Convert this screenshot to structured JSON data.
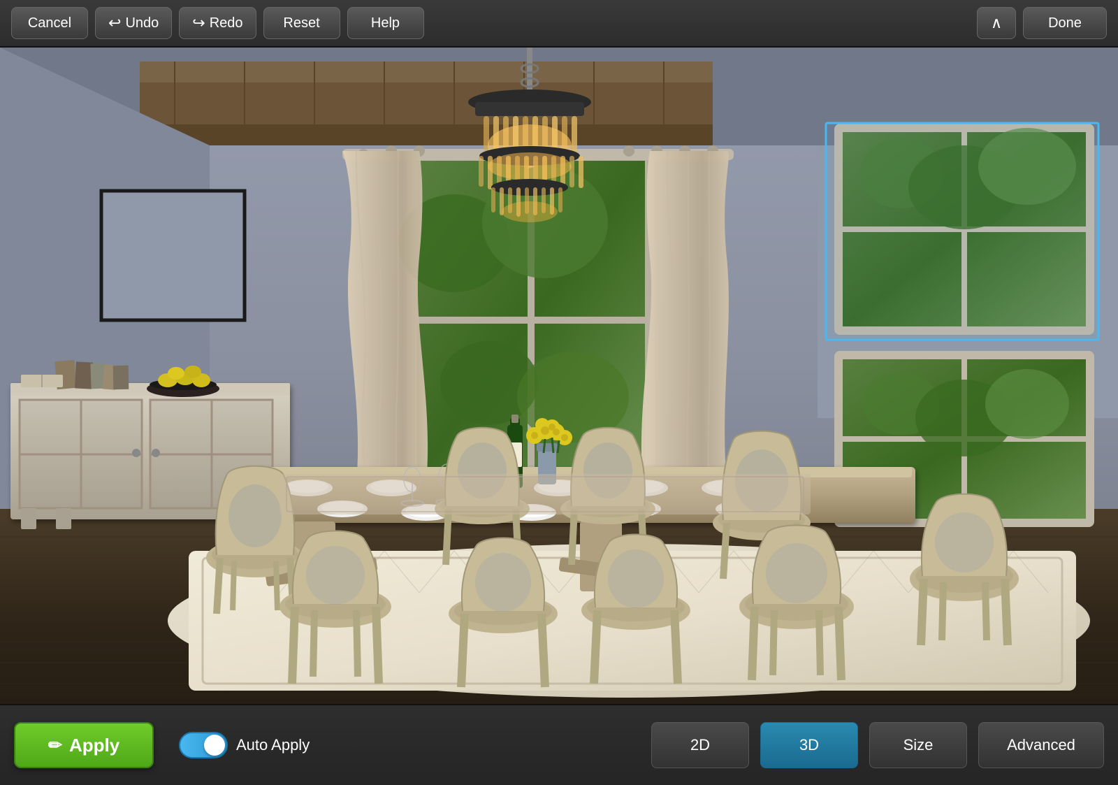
{
  "toolbar": {
    "cancel_label": "Cancel",
    "undo_label": "Undo",
    "redo_label": "Redo",
    "reset_label": "Reset",
    "help_label": "Help",
    "done_label": "Done"
  },
  "bottom": {
    "apply_label": "Apply",
    "auto_apply_label": "Auto Apply",
    "btn_2d_label": "2D",
    "btn_3d_label": "3D",
    "size_label": "Size",
    "advanced_label": "Advanced",
    "toggle_state": true
  },
  "scene": {
    "description": "Dining room 3D view",
    "selection_hint": "Selected wall area"
  },
  "icons": {
    "undo": "↩",
    "redo": "↪",
    "brush": "✏",
    "chevron_up": "^"
  }
}
